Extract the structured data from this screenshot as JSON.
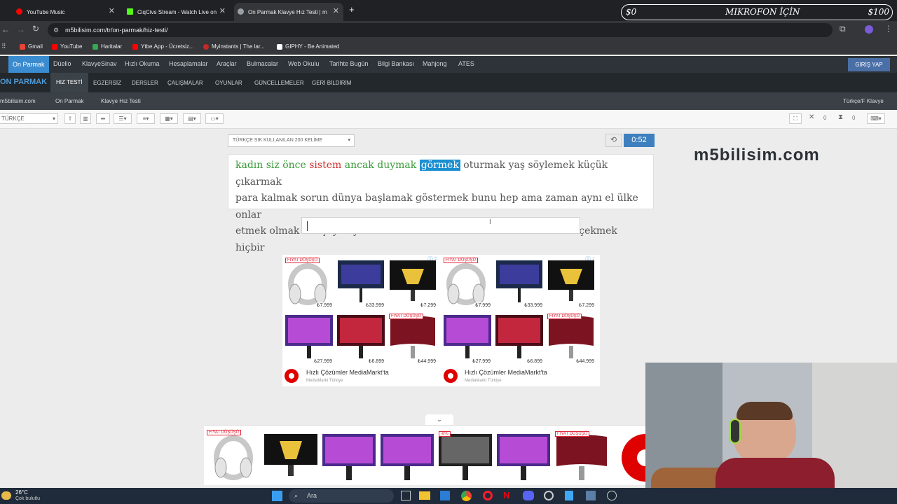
{
  "browser": {
    "tabs": [
      {
        "title": "YouTube Music",
        "color": "#ff0000"
      },
      {
        "title": "CiqCivs Stream - Watch Live on",
        "color": "#53fc18"
      },
      {
        "title": "On Parmak Klavye Hız Testi | m",
        "color": "#9aa0a6"
      }
    ],
    "overlay": {
      "left": "$0",
      "center": "MIKROFON İÇİN",
      "right": "$100"
    },
    "url": "m5bilisim.com/tr/on-parmak/hiz-testi/",
    "bookmarks": [
      "Gmail",
      "YouTube",
      "Haritalar",
      "Ytbe.App - Ücretsiz...",
      "Myinstants | The lar...",
      "GIPHY - Be Animated"
    ]
  },
  "site": {
    "nav1": [
      "On Parmak",
      "Düello",
      "KlavyeSinav",
      "Hızlı Okuma",
      "Hesaplamalar",
      "Araçlar",
      "Bulmacalar",
      "Web Okulu",
      "Tarihte Bugün",
      "Bilgi Bankası",
      "Mahjong",
      "ATES"
    ],
    "login": "GİRİŞ YAP",
    "brand": "ON PARMAK",
    "nav2": [
      "HIZ TESTİ",
      "EGZERSİZ",
      "DERSLER",
      "ÇALIŞMALAR",
      "OYUNLAR",
      "GÜNCELLEMELER",
      "GERİ BİLDİRİM"
    ],
    "watermark": "m5bilisim.com",
    "breadcrumb": [
      "m5bilisim.com",
      "On Parmak",
      "Klavye Hız Testi"
    ],
    "keyboard_layout": "Türkçe/F Klavye",
    "language": "TÜRKÇE",
    "counters": [
      "0",
      "0",
      "0"
    ]
  },
  "test": {
    "category": "TÜRKÇE SIK KULLANILAN 200 KELİME",
    "timer": "0:52",
    "line1_ok1": "kadın siz önce",
    "line1_bad": "sistem",
    "line1_ok2": "ancak duymak",
    "current": "görmek",
    "line1_rest": "oturmak yaş söylemek küçük çıkarmak",
    "line2": "para kalmak sorun dünya başlamak göstermek bunu hep ama zaman aynı el ülke onlar",
    "line3": "etmek olmak var şey koymak neden ürün ad o son sen demek birbiri çekmek hiçbir"
  },
  "ad": {
    "badge": "FIYAT DÜŞÜŞÜ",
    "prices_row1": [
      "₺7.999",
      "₺33.999",
      "₺7.299",
      "₺7.999",
      "₺33.999",
      "₺7.299"
    ],
    "prices_row2": [
      "₺27.999",
      "₺6.899",
      "₺44.999",
      "₺27.999",
      "₺6.899",
      "₺44.999"
    ],
    "title": "Hızlı Çözümler MediaMarkt'ta",
    "subtitle": "MediaMarkt Türkiye",
    "bottom_discount": "-8%"
  },
  "taskbar": {
    "temp": "26°C",
    "weather": "Çok bulutlu",
    "search": "Ara"
  }
}
